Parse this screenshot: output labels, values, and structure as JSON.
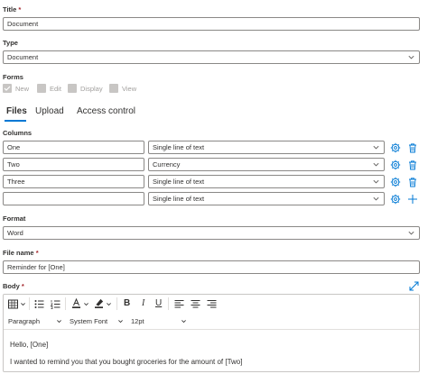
{
  "title_field": {
    "label": "Title",
    "value": "Document"
  },
  "type_field": {
    "label": "Type",
    "value": "Document"
  },
  "forms": {
    "label": "Forms",
    "options": [
      {
        "label": "New",
        "checked": true
      },
      {
        "label": "Edit",
        "checked": false
      },
      {
        "label": "Display",
        "checked": false
      },
      {
        "label": "View",
        "checked": false
      }
    ]
  },
  "tabs": [
    {
      "label": "Files",
      "active": true
    },
    {
      "label": "Upload",
      "active": false
    },
    {
      "label": "Access control",
      "active": false
    }
  ],
  "columns": {
    "label": "Columns",
    "rows": [
      {
        "name": "One",
        "type": "Single line of text"
      },
      {
        "name": "Two",
        "type": "Currency"
      },
      {
        "name": "Three",
        "type": "Single line of text"
      },
      {
        "name": "",
        "type": "Single line of text"
      }
    ]
  },
  "format_field": {
    "label": "Format",
    "value": "Word"
  },
  "filename_field": {
    "label": "File name",
    "value": "Reminder for [One]"
  },
  "body": {
    "label": "Body",
    "toolbar": {
      "block_format": "Paragraph",
      "font_family": "System Font",
      "font_size": "12pt"
    },
    "content": [
      "Hello, [One]",
      "I wanted to remind you that you bought groceries for the amount of [Two]"
    ]
  },
  "colors": {
    "accent": "#0078d4",
    "required": "#a4262c",
    "border": "#8a8886"
  }
}
